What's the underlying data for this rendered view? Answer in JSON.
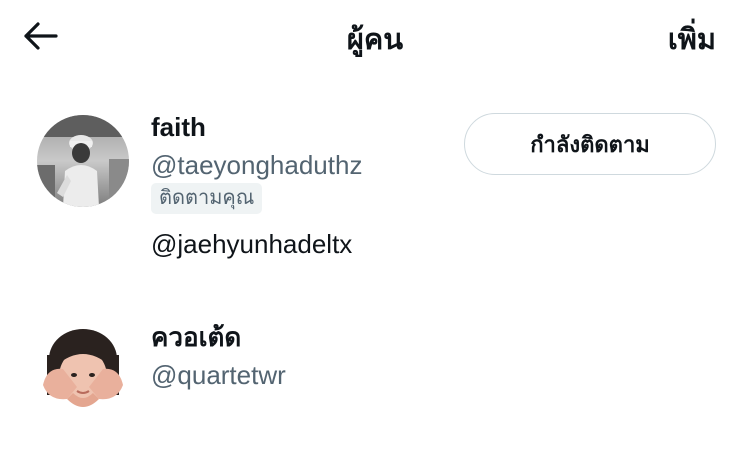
{
  "header": {
    "back_icon": "arrow-left-icon",
    "title": "ผู้คน",
    "more_label": "เพิ่ม"
  },
  "people": [
    {
      "name": "faith",
      "handle": "@taeyonghaduthz",
      "follows_you_badge": "ติดตามคุณ",
      "bio": "@jaehyunhadeltx",
      "follow_button_label": "กำลังติดตาม",
      "avatar": "grayscale-photo-person-in-cap"
    },
    {
      "name": "ควอเต้ด",
      "handle": "@quartetwr",
      "avatar": "photo-person-making-heart-hands"
    }
  ],
  "colors": {
    "text_primary": "#0f1419",
    "text_secondary": "#536471",
    "badge_bg": "#eff3f4",
    "button_border": "#cfd9de",
    "background": "#ffffff"
  }
}
